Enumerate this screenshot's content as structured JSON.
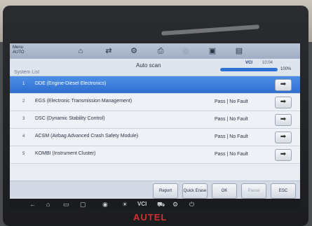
{
  "header": {
    "brand": "Menu",
    "brand_sub": "AUTO",
    "title": "Auto scan",
    "vci": "VCI",
    "clock": "10:04",
    "section": "System List",
    "progress_percent": 100,
    "progress_label": "100%"
  },
  "toolbar_icons": [
    "home-icon",
    "exchange-icon",
    "gear-icon",
    "print-icon",
    "help-icon",
    "save-icon",
    "data-icon"
  ],
  "systems": [
    {
      "num": "1",
      "name": "DDE (Engine-Diesel Electronics)",
      "status": "",
      "selected": true
    },
    {
      "num": "2",
      "name": "EGS (Electronic Transmission Management)",
      "status": "Pass | No Fault",
      "selected": false
    },
    {
      "num": "3",
      "name": "DSC (Dynamic Stability Control)",
      "status": "Pass | No Fault",
      "selected": false
    },
    {
      "num": "4",
      "name": "ACSM (Airbag Advanced Crash Safety Module)",
      "status": "Pass | No Fault",
      "selected": false
    },
    {
      "num": "5",
      "name": "KOMBI (Instrument Cluster)",
      "status": "Pass | No Fault",
      "selected": false
    }
  ],
  "buttons": {
    "report": "Report",
    "quick_erase": "Quick Erase",
    "ok": "OK",
    "pause": "Pause",
    "esc": "ESC"
  },
  "nav": {
    "vci": "VCI"
  },
  "device_logo": "AUTEL",
  "colors": {
    "selected_row": "#2f6fcf",
    "progress": "#2e73d4",
    "logo": "#d0302f"
  }
}
